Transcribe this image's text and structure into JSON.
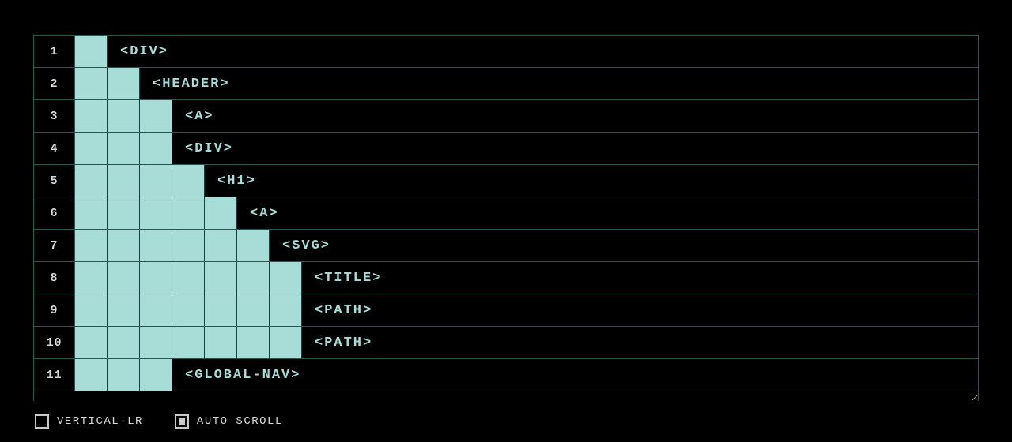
{
  "rows": [
    {
      "num": "1",
      "depth": 1,
      "tag": "<DIV>"
    },
    {
      "num": "2",
      "depth": 2,
      "tag": "<HEADER>"
    },
    {
      "num": "3",
      "depth": 3,
      "tag": "<A>"
    },
    {
      "num": "4",
      "depth": 3,
      "tag": "<DIV>"
    },
    {
      "num": "5",
      "depth": 4,
      "tag": "<H1>"
    },
    {
      "num": "6",
      "depth": 5,
      "tag": "<A>"
    },
    {
      "num": "7",
      "depth": 6,
      "tag": "<SVG>"
    },
    {
      "num": "8",
      "depth": 7,
      "tag": "<TITLE>"
    },
    {
      "num": "9",
      "depth": 7,
      "tag": "<PATH>"
    },
    {
      "num": "10",
      "depth": 7,
      "tag": "<PATH>"
    },
    {
      "num": "11",
      "depth": 3,
      "tag": "<GLOBAL-NAV>"
    }
  ],
  "controls": {
    "vertical_lr": {
      "label": "VERTICAL-LR",
      "checked": false
    },
    "auto_scroll": {
      "label": "AUTO SCROLL",
      "checked": true
    }
  }
}
